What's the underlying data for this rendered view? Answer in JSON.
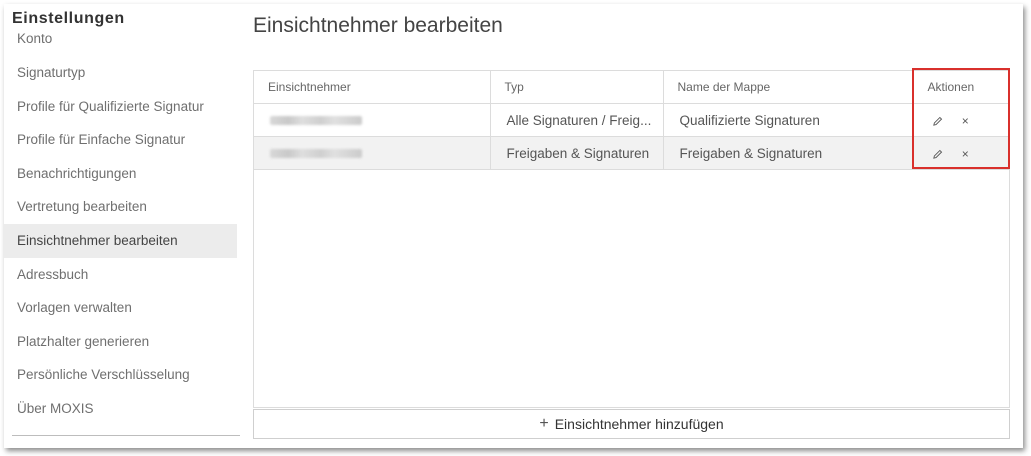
{
  "sidebar": {
    "title": "Einstellungen",
    "items": [
      {
        "label": "Konto"
      },
      {
        "label": "Signaturtyp"
      },
      {
        "label": "Profile für Qualifizierte Signatur"
      },
      {
        "label": "Profile für Einfache Signatur"
      },
      {
        "label": "Benachrichtigungen"
      },
      {
        "label": "Vertretung bearbeiten"
      },
      {
        "label": "Einsichtnehmer bearbeiten",
        "active": true
      },
      {
        "label": "Adressbuch"
      },
      {
        "label": "Vorlagen verwalten"
      },
      {
        "label": "Platzhalter generieren"
      },
      {
        "label": "Persönliche Verschlüsselung"
      },
      {
        "label": "Über MOXIS"
      }
    ]
  },
  "main": {
    "title": "Einsichtnehmer bearbeiten",
    "table": {
      "columns": [
        "Einsichtnehmer",
        "Typ",
        "Name der Mappe",
        "Aktionen"
      ],
      "rows": [
        {
          "name": "",
          "typ": "Alle Signaturen / Freig...",
          "mappe": "Qualifizierte Signaturen"
        },
        {
          "name": "",
          "typ": "Freigaben & Signaturen",
          "mappe": "Freigaben & Signaturen"
        }
      ]
    },
    "actions": {
      "edit_icon": "pencil-icon",
      "delete_icon": "close-icon",
      "delete_glyph": "×"
    },
    "add_button": {
      "plus": "+",
      "label": "Einsichtnehmer hinzufügen"
    }
  },
  "colors": {
    "highlight": "#d9302c",
    "active_item_bg": "#ececec",
    "row_alt_bg": "#f2f2f2"
  }
}
